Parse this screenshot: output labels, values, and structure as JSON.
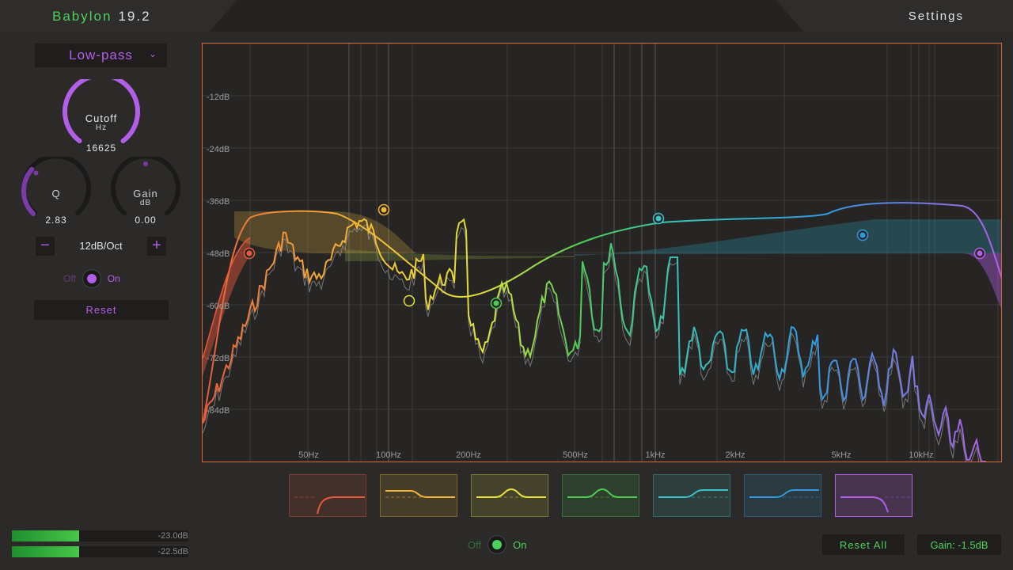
{
  "app": {
    "name": "Babylon",
    "version": "19.2",
    "settings_label": "Settings"
  },
  "filter_panel": {
    "type_selected": "Low-pass",
    "cutoff": {
      "label": "Cutoff",
      "unit": "Hz",
      "value": "16625",
      "level": 0.93
    },
    "q": {
      "label": "Q",
      "value": "2.83",
      "level": 0.32
    },
    "gain": {
      "label": "Gain",
      "unit": "dB",
      "value": "0.00",
      "level": 0.5
    },
    "slope": {
      "minus": "−",
      "value": "12dB/Oct",
      "plus": "+"
    },
    "band_toggle": {
      "off_label": "Off",
      "on_label": "On",
      "state": "on"
    },
    "reset_label": "Reset",
    "accent_color": "#b35ee8"
  },
  "chart_data": {
    "type": "line",
    "y_axis_labels": [
      "-12dB",
      "-24dB",
      "-36dB",
      "-48dB",
      "-60dB",
      "-72dB",
      "-84dB"
    ],
    "x_axis_labels": [
      "50Hz",
      "100Hz",
      "200Hz",
      "500Hz",
      "1kHz",
      "2kHz",
      "5kHz",
      "10kHz"
    ],
    "band_colors": [
      "#e8583b",
      "#f2b534",
      "#e8e23c",
      "#4ccc55",
      "#39c3cc",
      "#2f9ae0",
      "#b35ee8"
    ],
    "bands": [
      {
        "type": "high-pass",
        "color": "#e8583b"
      },
      {
        "type": "low-shelf",
        "color": "#f2b534"
      },
      {
        "type": "bell",
        "color": "#e8e23c"
      },
      {
        "type": "bell",
        "color": "#4ccc55"
      },
      {
        "type": "high-shelf",
        "color": "#39c3cc"
      },
      {
        "type": "high-shelf",
        "color": "#2f9ae0"
      },
      {
        "type": "low-pass",
        "color": "#b35ee8",
        "selected": true
      }
    ]
  },
  "global": {
    "toggle": {
      "off_label": "Off",
      "on_label": "On",
      "state": "on"
    },
    "reset_all_label": "Reset All",
    "gain_label": "Gain: -1.5dB",
    "accent_color": "#4fd05c"
  },
  "meters": [
    {
      "value": "-23.0dB",
      "level": 0.38
    },
    {
      "value": "-22.5dB",
      "level": 0.38
    }
  ]
}
